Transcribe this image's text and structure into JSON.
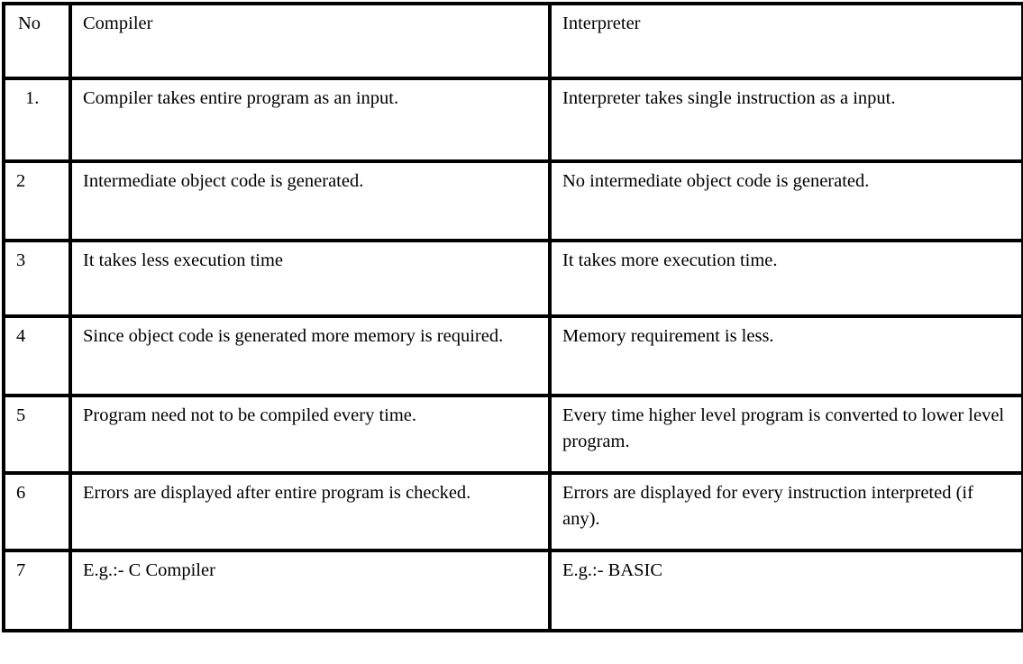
{
  "table": {
    "columns": [
      {
        "key": "no",
        "label": "No"
      },
      {
        "key": "compiler",
        "label": "Compiler"
      },
      {
        "key": "interpreter",
        "label": "Interpreter"
      }
    ],
    "rows": [
      {
        "no": "1.",
        "compiler": "Compiler takes entire program as an input.",
        "interpreter": "Interpreter takes single instruction as a input."
      },
      {
        "no": "2",
        "compiler": "Intermediate object code is generated.",
        "interpreter": "No intermediate object code is generated."
      },
      {
        "no": "3",
        "compiler": "It takes less execution time",
        "interpreter": "It takes more execution time."
      },
      {
        "no": "4",
        "compiler": "Since object code is generated more memory is required.",
        "interpreter": "Memory requirement is less."
      },
      {
        "no": "5",
        "compiler": "Program need not to be compiled every time.",
        "interpreter": "Every time higher level program is converted to lower level program."
      },
      {
        "no": "6",
        "compiler": "Errors are displayed after entire program is checked.",
        "interpreter": "Errors are displayed for every instruction interpreted (if any)."
      },
      {
        "no": "7",
        "compiler": "E.g.:- C Compiler",
        "interpreter": "E.g.:- BASIC"
      }
    ]
  },
  "colors": {
    "border": "#000000",
    "background": "#ffffff",
    "text": "#000000"
  }
}
